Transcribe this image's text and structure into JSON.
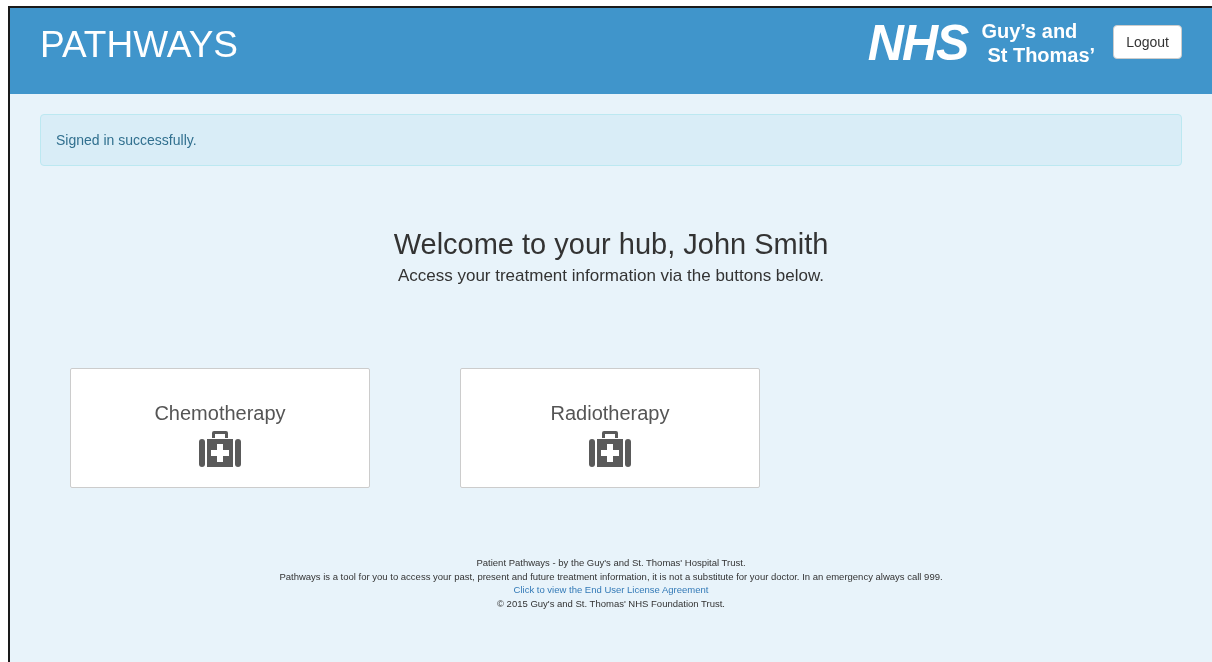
{
  "header": {
    "title": "PATHWAYS",
    "logo": {
      "mark": "NHS",
      "line_1": "Guy’s and",
      "line_2": "St Thomas’"
    },
    "logout_button": "Logout"
  },
  "alert": {
    "message": "Signed in successfully."
  },
  "welcome": {
    "heading": "Welcome to your hub, John Smith",
    "subtitle": "Access your treatment information via the buttons below."
  },
  "cards": [
    {
      "label": "Chemotherapy"
    },
    {
      "label": "Radiotherapy"
    }
  ],
  "footer": {
    "lines": [
      {
        "kind": "text",
        "text": "Patient Pathways - by the Guy's and St. Thomas' Hospital Trust."
      },
      {
        "kind": "text",
        "text": "Pathways is a tool for you to access your past, present and future treatment information, it is not a substitute for your doctor. In an emergency always call 999."
      },
      {
        "kind": "link",
        "text": "Click to view the End User License Agreement"
      },
      {
        "kind": "text",
        "text": "© 2015 Guy's and St. Thomas' NHS Foundation Trust."
      }
    ]
  }
}
